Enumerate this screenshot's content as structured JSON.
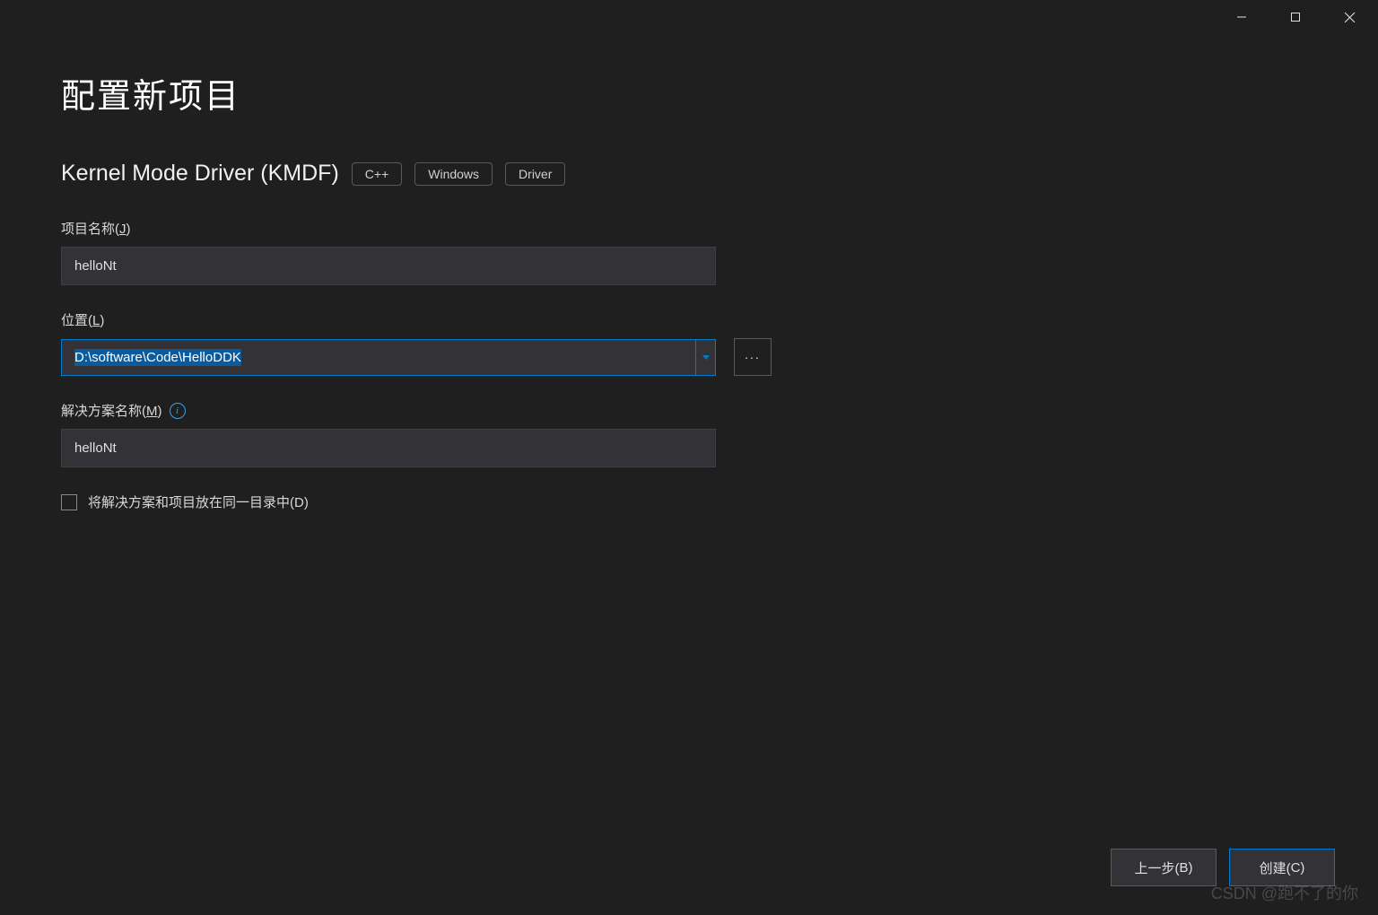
{
  "titlebar": {
    "minimize": "minimize",
    "maximize": "maximize",
    "close": "close"
  },
  "page": {
    "title": "配置新项目"
  },
  "template": {
    "name": "Kernel Mode Driver (KMDF)",
    "tags": [
      "C++",
      "Windows",
      "Driver"
    ]
  },
  "fields": {
    "project_name": {
      "label_prefix": "项目名称(",
      "label_key": "J",
      "label_suffix": ")",
      "value": "helloNt"
    },
    "location": {
      "label_prefix": "位置(",
      "label_key": "L",
      "label_suffix": ")",
      "value": "D:\\software\\Code\\HelloDDK",
      "browse": "..."
    },
    "solution_name": {
      "label_prefix": "解决方案名称(",
      "label_key": "M",
      "label_suffix": ")",
      "value": "helloNt"
    },
    "same_dir": {
      "label_prefix": "将解决方案和项目放在同一目录中(",
      "label_key": "D",
      "label_suffix": ")",
      "checked": false
    }
  },
  "footer": {
    "back_prefix": "上一步(",
    "back_key": "B",
    "back_suffix": ")",
    "create_prefix": "创建(",
    "create_key": "C",
    "create_suffix": ")"
  },
  "watermark": "CSDN @跑不了的你"
}
